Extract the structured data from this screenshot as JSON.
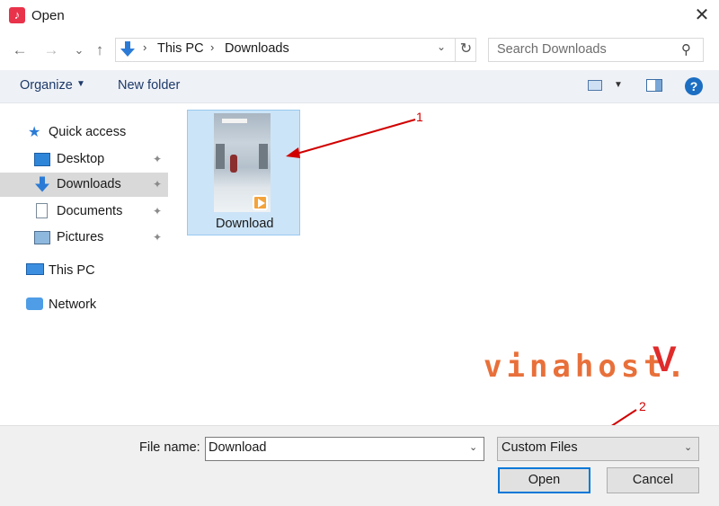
{
  "window": {
    "title": "Open",
    "app_icon": "tiktok-icon",
    "close_glyph": "✕"
  },
  "nav_buttons": {
    "back": "←",
    "forward": "→",
    "recent": "⌄",
    "up": "↑"
  },
  "address": {
    "segments": [
      "This PC",
      "Downloads"
    ],
    "separator": "›",
    "refresh": "↻"
  },
  "search": {
    "placeholder": "Search Downloads"
  },
  "toolbar": {
    "organize": "Organize",
    "new_folder": "New folder",
    "help": "?"
  },
  "sidebar": {
    "items": [
      {
        "label": "Quick access",
        "icon": "star-icon"
      },
      {
        "label": "Desktop",
        "icon": "desktop-icon",
        "pinned": true
      },
      {
        "label": "Downloads",
        "icon": "download-arrow-icon",
        "pinned": true,
        "selected": true
      },
      {
        "label": "Documents",
        "icon": "documents-icon",
        "pinned": true
      },
      {
        "label": "Pictures",
        "icon": "pictures-icon",
        "pinned": true
      },
      {
        "label": "This PC",
        "icon": "computer-icon"
      },
      {
        "label": "Network",
        "icon": "network-icon"
      }
    ],
    "pin_glyph": "📌"
  },
  "files": [
    {
      "name": "Download",
      "type": "video",
      "selected": true
    }
  ],
  "watermark": {
    "text": "vinahost.",
    "mark": "V"
  },
  "annotations": [
    {
      "label": "1"
    },
    {
      "label": "2"
    }
  ],
  "bottom": {
    "file_name_label": "File name:",
    "file_name_value": "Download",
    "filter_value": "Custom Files",
    "open_label": "Open",
    "cancel_label": "Cancel"
  },
  "colors": {
    "accent": "#0078d7",
    "selection": "#cce4f7",
    "annotation": "#d10000"
  }
}
